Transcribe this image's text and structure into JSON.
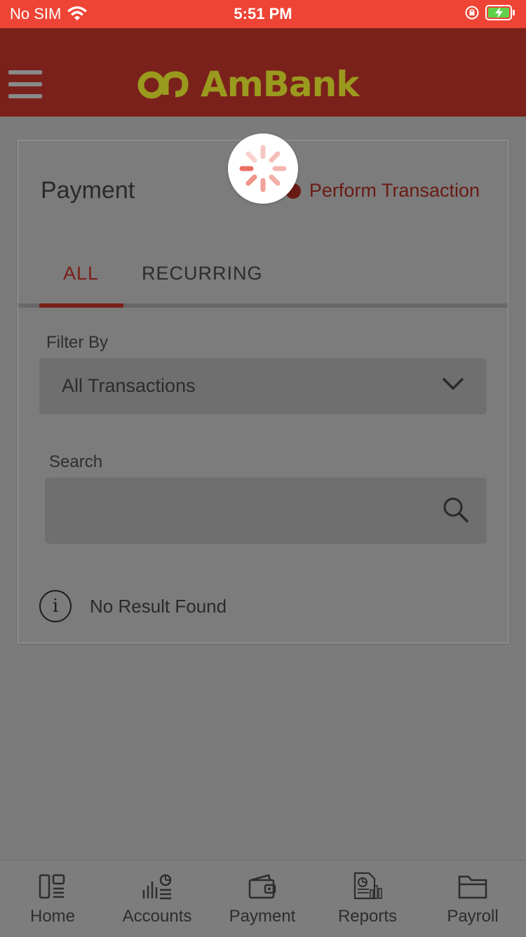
{
  "status_bar": {
    "carrier": "No SIM",
    "time": "5:51 PM"
  },
  "header": {
    "logo_text": "AmBank"
  },
  "page": {
    "title": "Payment",
    "perform_link": "Perform Transaction",
    "tabs": [
      {
        "label": "ALL",
        "active": true
      },
      {
        "label": "RECURRING",
        "active": false
      }
    ],
    "filter": {
      "label": "Filter By",
      "value": "All Transactions"
    },
    "search": {
      "label": "Search",
      "value": ""
    },
    "empty_state": "No Result Found"
  },
  "bottom_nav": [
    {
      "label": "Home",
      "icon": "home-icon"
    },
    {
      "label": "Accounts",
      "icon": "accounts-icon"
    },
    {
      "label": "Payment",
      "icon": "wallet-icon"
    },
    {
      "label": "Reports",
      "icon": "reports-icon"
    },
    {
      "label": "Payroll",
      "icon": "folder-icon"
    }
  ],
  "colors": {
    "status_bar": "#ee4435",
    "header": "#7b211b",
    "logo": "#9a9a1e",
    "accent": "#7b1f19",
    "overlay_bg": "#7b7b7b"
  }
}
